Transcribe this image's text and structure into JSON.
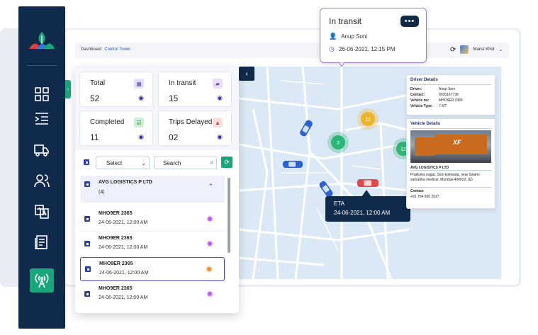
{
  "sidebar": {
    "icons": [
      "dashboard-grid-icon",
      "list-indent-icon",
      "truck-icon",
      "users-icon",
      "translate-icon",
      "document-icon",
      "signal-tower-icon"
    ]
  },
  "topbar": {
    "breadcrumb_root": "Dashboard",
    "breadcrumb_current": "Control Tower",
    "user_name": "Mansi Khot"
  },
  "stats": [
    {
      "label": "Total",
      "value": "52",
      "color": "#5b48d6"
    },
    {
      "label": "In transit",
      "value": "15",
      "color": "#7b3fd1"
    },
    {
      "label": "Completed",
      "value": "11",
      "color": "#1f8a3a"
    },
    {
      "label": "Trips Delayed",
      "value": "02",
      "color": "#d63b3b"
    }
  ],
  "filters": {
    "select_label": "Select",
    "search_placeholder": "Search"
  },
  "group": {
    "name": "AVG LOGISTICS P LTD",
    "count": "(4)"
  },
  "vehicles": [
    {
      "number": "MHO9ER 2365",
      "time": "24-06-2021, 12:00 AM",
      "status_color": "#b65cf0"
    },
    {
      "number": "MHO9ER 2365",
      "time": "24-06-2021, 12:00 AM",
      "status_color": "#b65cf0"
    },
    {
      "number": "MHO9ER 2365",
      "time": "24-06-2021, 12:00 AM",
      "status_color": "#f08a3c"
    },
    {
      "number": "MHO9ER 2365",
      "time": "24-06-2021, 12:00 AM",
      "status_color": "#b65cf0"
    }
  ],
  "transit_popup": {
    "title": "In transit",
    "driver": "Anup Soni",
    "datetime": "26-06-2021, 12:15 PM"
  },
  "eta_popup": {
    "label": "ETA",
    "datetime": "24-06-2021, 12:00 AM"
  },
  "map_markers": [
    {
      "label": "12",
      "color": "#f0b429"
    },
    {
      "label": "3",
      "color": "#2bb673"
    },
    {
      "label": "12",
      "color": "#2bb673"
    }
  ],
  "driver_details": {
    "title": "Driver Details",
    "rows": [
      {
        "key": "Driver:",
        "value": "Anup Soni"
      },
      {
        "key": "Contact:",
        "value": "9930167738"
      },
      {
        "key": "Vehicle no:",
        "value": "MHO9ER 2365"
      },
      {
        "key": "Vehicle Type:",
        "value": "7 MT"
      }
    ]
  },
  "vehicle_details": {
    "title": "Vehicle Details",
    "truck_brand": "XF",
    "company": "AVG LOGISTICS P LTD",
    "address": "Pratiksha nagar, Sion koliwada, near Swami samartha medical, Mumbai-400022, (E)",
    "contact_label": "Contact",
    "contact": "+91 704 550 2917"
  }
}
